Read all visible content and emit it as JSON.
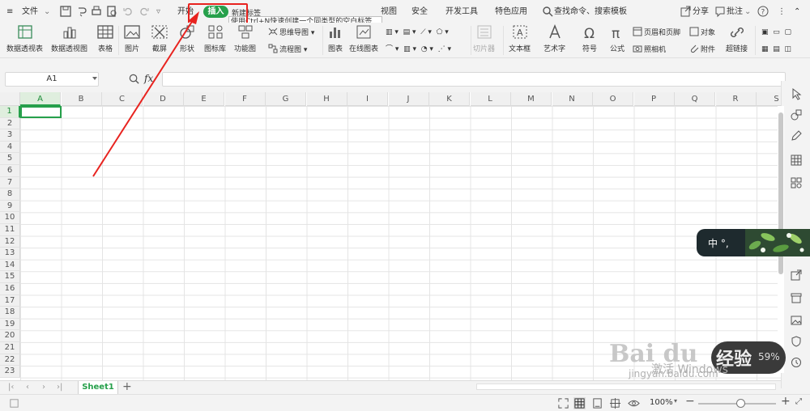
{
  "menubar": {
    "file_label": "文件",
    "tabs": [
      {
        "label": "开始"
      },
      {
        "label": "插入"
      },
      {
        "label": "视图"
      },
      {
        "label": "安全"
      },
      {
        "label": "开发工具"
      },
      {
        "label": "特色应用"
      }
    ],
    "search_label": "查找命令、搜索模板",
    "share_label": "分享",
    "comment_label": "批注",
    "tooltip_title": "新建标签",
    "tooltip_text": "使用Ctrl+N快速创建一个同类型的空白标签"
  },
  "ribbon": {
    "pivot_table": "数据透视表",
    "pivot_chart": "数据透视图",
    "table": "表格",
    "picture": "图片",
    "screenshot": "截屏",
    "shape": "形状",
    "icon_lib": "图标库",
    "function_chart": "功能图",
    "mind_map": "思维导图",
    "flow_chart": "流程图",
    "chart": "图表",
    "online_chart": "在线图表",
    "slicer": "切片器",
    "text_box": "文本框",
    "art_text": "艺术字",
    "symbol": "符号",
    "formula": "公式",
    "header_footer": "页眉和页脚",
    "camera": "照相机",
    "object": "对象",
    "attachment": "附件",
    "hyperlink": "超链接"
  },
  "formula_bar": {
    "cell_ref": "A1",
    "fx": "fx"
  },
  "grid": {
    "columns": [
      "A",
      "B",
      "C",
      "D",
      "E",
      "F",
      "G",
      "H",
      "I",
      "J",
      "K",
      "L",
      "M",
      "N",
      "O",
      "P",
      "Q",
      "R",
      "S"
    ],
    "rows": [
      "1",
      "2",
      "3",
      "4",
      "5",
      "6",
      "7",
      "8",
      "9",
      "10",
      "11",
      "12",
      "13",
      "14",
      "15",
      "16",
      "17",
      "18",
      "19",
      "20",
      "21",
      "22",
      "23"
    ]
  },
  "sheets": {
    "tabs": [
      "Sheet1"
    ],
    "add": "+"
  },
  "status": {
    "zoom": "100%",
    "zoom_minus": "−",
    "zoom_plus": "+"
  },
  "ime": {
    "text": "中 °,"
  },
  "watermark": {
    "activate": "激活 Windows",
    "baidu": "Bai du",
    "jingyan": "经验",
    "percent": "59%",
    "url": "jingyan.baidu.com"
  },
  "colors": {
    "accent": "#26a04b",
    "highlight": "#e8231f"
  }
}
